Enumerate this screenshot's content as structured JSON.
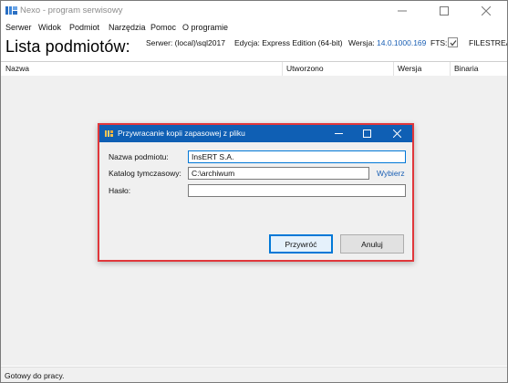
{
  "window": {
    "title": "Nexo - program serwisowy"
  },
  "menu": [
    "Serwer",
    "Widok",
    "Podmiot",
    "Narzędzia",
    "Pomoc",
    "O programie"
  ],
  "header": {
    "page_title": "Lista podmiotów:",
    "server_label": "Serwer:",
    "server_value": "(local)\\sql2017",
    "edition_label": "Edycja:",
    "edition_value": "Express Edition (64-bit)",
    "version_label": "Wersja:",
    "version_value": "14.0.1000.169",
    "fts_label": "FTS:",
    "fts_checked": true,
    "filestream_label": "FILESTREAM"
  },
  "table": {
    "columns": [
      "Nazwa",
      "Utworzono",
      "Wersja",
      "Binaria"
    ]
  },
  "status": {
    "text": "Gotowy do pracy."
  },
  "dialog": {
    "title": "Przywracanie kopii zapasowej z pliku",
    "name_label": "Nazwa podmiotu:",
    "name_value": "InsERT S.A.",
    "temp_dir_label": "Katalog tymczasowy:",
    "temp_dir_value": "C:\\archiwum",
    "choose_label": "Wybierz",
    "password_label": "Hasło:",
    "password_value": "",
    "restore_button": "Przywróć",
    "cancel_button": "Anuluj"
  },
  "colors": {
    "dialog_title_bg": "#0f5fb4",
    "dialog_border": "#e0373b",
    "link": "#1a5fb4",
    "focus": "#0078d7"
  }
}
